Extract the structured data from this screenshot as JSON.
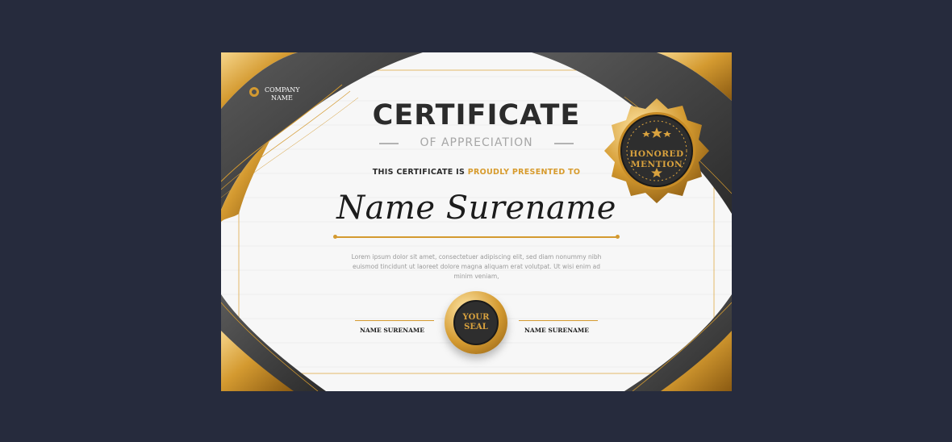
{
  "company": {
    "line1": "COMPANY",
    "line2": "NAME"
  },
  "certificate": {
    "title": "CERTIFICATE",
    "subtitle": "OF APPRECIATION",
    "presented_prefix": "THIS CERTIFICATE IS ",
    "presented_highlight": "PROUDLY PRESENTED TO",
    "recipient": "Name Surename",
    "body": "Lorem ipsum dolor sit amet, consectetuer adipiscing elit, sed diam nonummy nibh euismod tincidunt ut laoreet dolore magna aliquam erat volutpat. Ut wisi enim ad minim veniam,"
  },
  "badge": {
    "line1": "HONORED",
    "line2": "MENTION"
  },
  "seal": {
    "line1": "YOUR",
    "line2": "SEAL"
  },
  "signatures": {
    "left_name": "NAME SURENAME",
    "right_name": "NAME SURENAME"
  },
  "colors": {
    "page_background": "#262b3d",
    "gold": "#d49a30",
    "dark_band": "#3a3a3a",
    "paper": "#f7f7f7"
  },
  "icons": {
    "logo": "gold-ring-icon",
    "badge_stars": "star-icon"
  }
}
